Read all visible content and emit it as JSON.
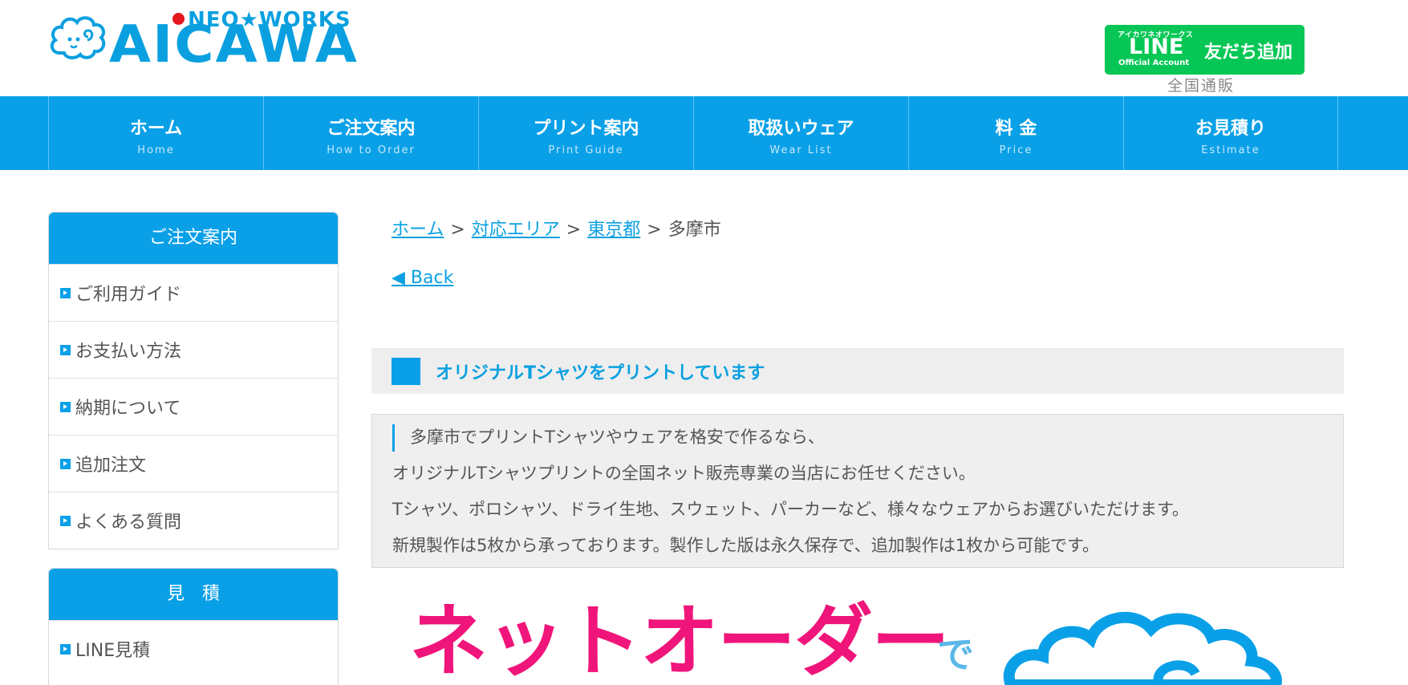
{
  "header": {
    "logo_top": "NEO★WORKS",
    "logo_main": "AICAWA",
    "line_small": "アイカワネオワークス",
    "line_big": "LINE",
    "line_oa": "Official Account",
    "line_add": "友だち追加",
    "zenkoku": "全国通販"
  },
  "nav": [
    {
      "label": "ホーム",
      "sub": "Home"
    },
    {
      "label": "ご注文案内",
      "sub": "How to Order"
    },
    {
      "label": "プリント案内",
      "sub": "Print Guide"
    },
    {
      "label": "取扱いウェア",
      "sub": "Wear List"
    },
    {
      "label": "料 金",
      "sub": "Price"
    },
    {
      "label": "お見積り",
      "sub": "Estimate"
    }
  ],
  "sidebar": {
    "order": {
      "title": "ご注文案内",
      "items": [
        "ご利用ガイド",
        "お支払い方法",
        "納期について",
        "追加注文",
        "よくある質問"
      ]
    },
    "estimate": {
      "title": "見　積",
      "items": [
        "LINE見積"
      ]
    }
  },
  "breadcrumb": {
    "home": "ホーム",
    "area": "対応エリア",
    "pref": "東京都",
    "current": "多摩市",
    "sep": ">"
  },
  "back_label": "◀ Back",
  "heading": "オリジナルTシャツをプリントしています",
  "intro": [
    "多摩市でプリントTシャツやウェアを格安で作るなら、",
    "オリジナルTシャツプリントの全国ネット販売専業の当店にお任せください。",
    "Tシャツ、ポロシャツ、ドライ生地、スウェット、パーカーなど、様々なウェアからお選びいただけます。",
    "新規製作は5枚から承っております。製作した版は永久保存で、追加製作は1枚から可能です。"
  ],
  "banner": {
    "text": "ネットオーダー",
    "de": "で"
  },
  "colors": {
    "brand_blue": "#0aa0e8",
    "line_green": "#06c755",
    "banner_pink": "#f0157a"
  }
}
